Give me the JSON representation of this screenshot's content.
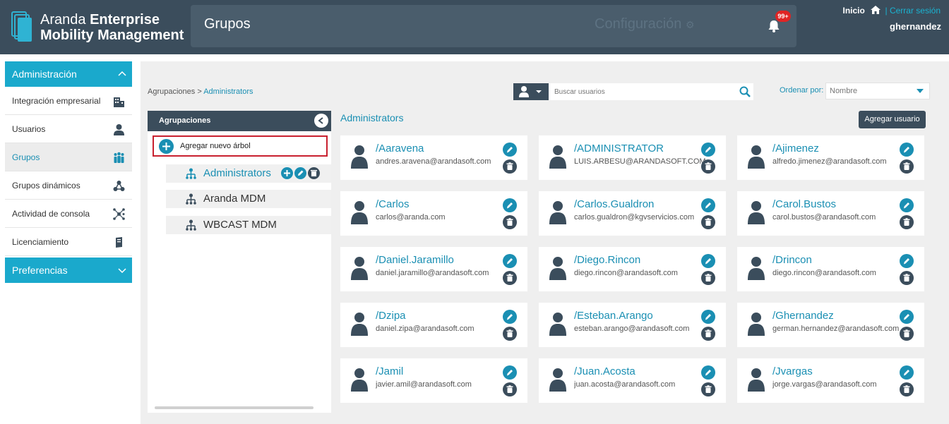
{
  "header": {
    "brand_light": "Aranda ",
    "brand_bold": "Enterprise",
    "brand_line2": "Mobility Management",
    "page_title": "Grupos",
    "config_label": "Configuración",
    "notifications_badge": "99+",
    "home_label": "Inicio",
    "separator": " | ",
    "logout_label": "Cerrar sesión",
    "username": "ghernandez"
  },
  "sidebar": {
    "admin_label": "Administración",
    "items": [
      {
        "label": "Integración empresarial",
        "icon": "building-icon"
      },
      {
        "label": "Usuarios",
        "icon": "user-icon"
      },
      {
        "label": "Grupos",
        "icon": "group-icon"
      },
      {
        "label": "Grupos dinámicos",
        "icon": "nodes-icon"
      },
      {
        "label": "Actividad de consola",
        "icon": "network-icon"
      },
      {
        "label": "Licenciamiento",
        "icon": "license-icon"
      }
    ],
    "active_item": "Grupos",
    "prefs_label": "Preferencias"
  },
  "breadcrumb": {
    "root": "Agrupaciones",
    "separator": " > ",
    "current": "Administrators"
  },
  "search": {
    "placeholder": "Buscar usuarios"
  },
  "order": {
    "label": "Ordenar por:",
    "value": "Nombre"
  },
  "tree": {
    "header": "Agrupaciones",
    "add_label": "Agregar nuevo árbol",
    "nodes": [
      "Administrators",
      "Aranda MDM",
      "WBCAST MDM"
    ],
    "selected": "Administrators"
  },
  "group_title": "Administrators",
  "add_user_label": "Agregar usuario",
  "users": [
    {
      "name": "/Aaravena",
      "email": "andres.aravena@arandasoft.com"
    },
    {
      "name": "/ADMINISTRATOR",
      "email": "LUIS.ARBESU@ARANDASOFT.COM"
    },
    {
      "name": "/Ajimenez",
      "email": "alfredo.jimenez@arandasoft.com"
    },
    {
      "name": "/Carlos",
      "email": "carlos@aranda.com"
    },
    {
      "name": "/Carlos.Gualdron",
      "email": "carlos.gualdron@kgvservicios.com"
    },
    {
      "name": "/Carol.Bustos",
      "email": "carol.bustos@arandasoft.com"
    },
    {
      "name": "/Daniel.Jaramillo",
      "email": "daniel.jaramillo@arandasoft.com"
    },
    {
      "name": "/Diego.Rincon",
      "email": "diego.rincon@arandasoft.com"
    },
    {
      "name": "/Drincon",
      "email": "diego.rincon@arandasoft.com"
    },
    {
      "name": "/Dzipa",
      "email": "daniel.zipa@arandasoft.com"
    },
    {
      "name": "/Esteban.Arango",
      "email": "esteban.arango@arandasoft.com"
    },
    {
      "name": "/Ghernandez",
      "email": "german.hernandez@arandasoft.com"
    },
    {
      "name": "/Jamil",
      "email": "javier.amil@arandasoft.com"
    },
    {
      "name": "/Juan.Acosta",
      "email": "juan.acosta@arandasoft.com"
    },
    {
      "name": "/Jvargas",
      "email": "jorge.vargas@arandasoft.com"
    }
  ],
  "colors": {
    "header_bg": "#3b4d5c",
    "accent": "#1aa9cc",
    "link": "#1a8fb3",
    "highlight_border": "#c8202f",
    "badge": "#e02424"
  }
}
